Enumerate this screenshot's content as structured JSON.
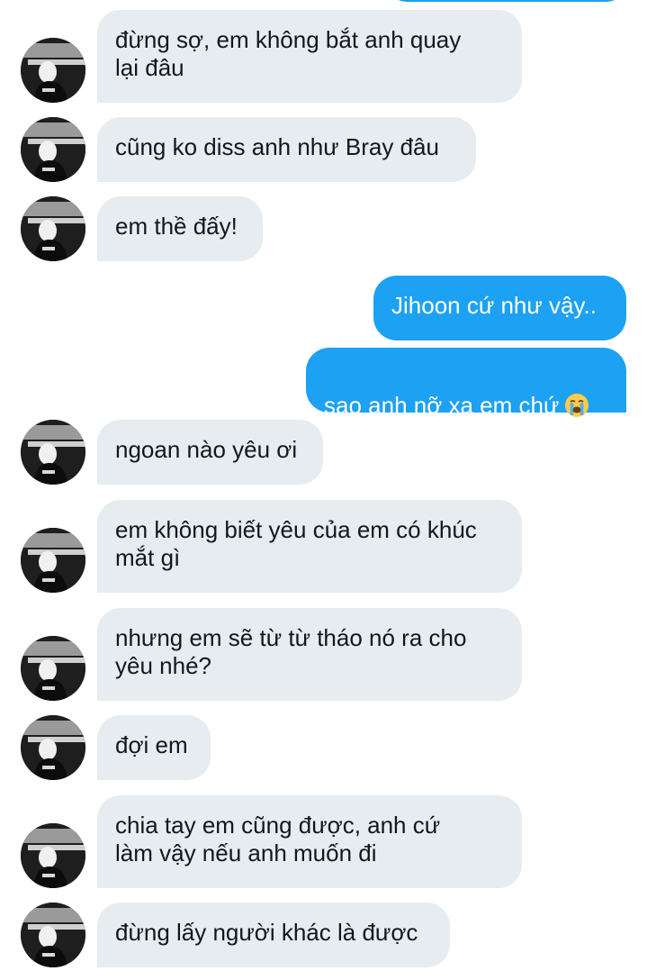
{
  "conversation": {
    "messages": [
      {
        "sender": "them",
        "text": "đừng sợ, em không bắt anh quay\nlại đâu"
      },
      {
        "sender": "them",
        "text": "cũng ko diss anh như Bray đâu"
      },
      {
        "sender": "them",
        "text": "em thề đấy!"
      },
      {
        "sender": "me",
        "text": "Jihoon cứ như vậy.."
      },
      {
        "sender": "me",
        "text": "sao anh nỡ xa em chứ",
        "emoji": "loudly-crying-face-emoji"
      },
      {
        "sender": "them",
        "text": "ngoan nào yêu ơi"
      },
      {
        "sender": "them",
        "text": "em không biết yêu của em có khúc\nmắt gì"
      },
      {
        "sender": "them",
        "text": "nhưng em sẽ từ từ tháo nó ra cho\nyêu nhé?"
      },
      {
        "sender": "them",
        "text": "đợi em"
      },
      {
        "sender": "them",
        "text": "chia tay em cũng được, anh cứ\nlàm vậy nếu anh muốn đi"
      },
      {
        "sender": "them",
        "text": "đừng lấy người khác là được"
      }
    ]
  },
  "colors": {
    "incoming_bubble": "#e6ecf0",
    "outgoing_bubble": "#1da1f2",
    "incoming_text": "#14171a",
    "outgoing_text": "#ffffff"
  }
}
